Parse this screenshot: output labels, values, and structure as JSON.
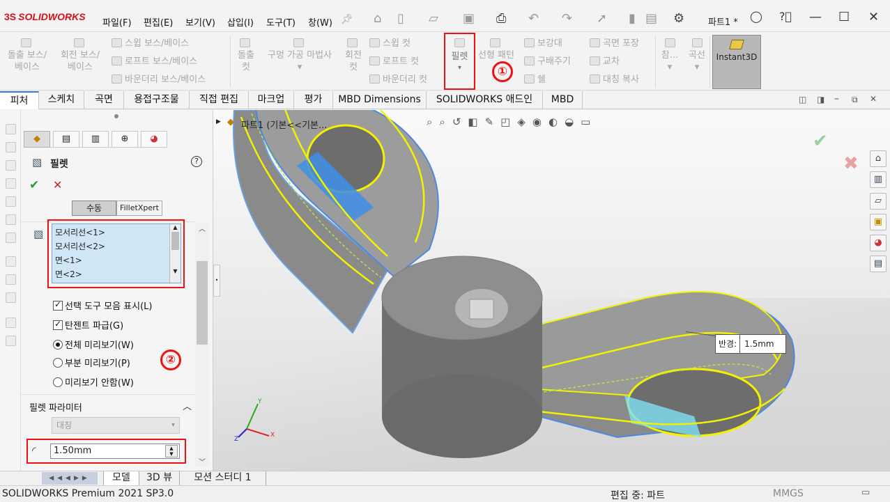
{
  "app": {
    "logo": "SOLIDWORKS",
    "logo_mark": "3S",
    "doc_name": "파트1 *"
  },
  "menu": [
    "파일(F)",
    "편집(E)",
    "보기(V)",
    "삽입(I)",
    "도구(T)",
    "창(W)"
  ],
  "ribbon": {
    "boss_extrude": "돌출 보스/\n베이스",
    "boss_revolve": "회전 보스/\n베이스",
    "sweep_boss": "스윕 보스/베이스",
    "loft_boss": "로프트 보스/베이스",
    "boundary_boss": "바운더리 보스/베이스",
    "cut_extrude": "돌출\n컷",
    "hole_wizard": "구멍 가공 마법사",
    "cut_revolve": "회전\n컷",
    "sweep_cut": "스윕 컷",
    "loft_cut": "로프트 컷",
    "boundary_cut": "바운더리 컷",
    "fillet": "필렛",
    "linear_pattern": "선형 패턴",
    "rib": "보강대",
    "draft": "구배주기",
    "shell": "쉘",
    "wrap": "곡면 포장",
    "intersect": "교차",
    "mirror": "대칭 복사",
    "ref": "참...",
    "curves": "곡선",
    "instant3d": "Instant3D"
  },
  "annotations": {
    "one": "①",
    "two": "②"
  },
  "tabs": [
    "피처",
    "스케치",
    "곡면",
    "용접구조물",
    "직접 편집",
    "마크업",
    "평가",
    "MBD Dimensions",
    "SOLIDWORKS 애드인",
    "MBD"
  ],
  "pm": {
    "title": "필렛",
    "help": "?",
    "manual_tab": "수동",
    "filletxpert_tab": "FilletXpert",
    "items": [
      "모서리선<1>",
      "모서리선<2>",
      "면<1>",
      "면<2>"
    ],
    "show_toolbar": "선택 도구 모음 표시(L)",
    "tangent": "탄젠트 파급(G)",
    "full_preview": "전체 미리보기(W)",
    "partial_preview": "부분 미리보기(P)",
    "no_preview": "미리보기 안함(W)",
    "params_header": "필렛 파라미터",
    "symmetric": "대칭",
    "radius": "1.50mm"
  },
  "viewport": {
    "tree": "파트1  (기본<<기본...",
    "callout_label": "반경:",
    "callout_value": "1.5mm",
    "axis_x": "X",
    "axis_y": "Y",
    "axis_z": "Z"
  },
  "bottom_tabs": [
    "모델",
    "3D 뷰",
    "모션 스터디 1"
  ],
  "status": {
    "left": "SOLIDWORKS Premium 2021 SP3.0",
    "mode": "편집 중: 파트",
    "units": "MMGS"
  },
  "colors": {
    "brand": "#d4121b",
    "highlight": "#ee1111",
    "edge": "#f5f500",
    "body": "#8c8c8c"
  }
}
